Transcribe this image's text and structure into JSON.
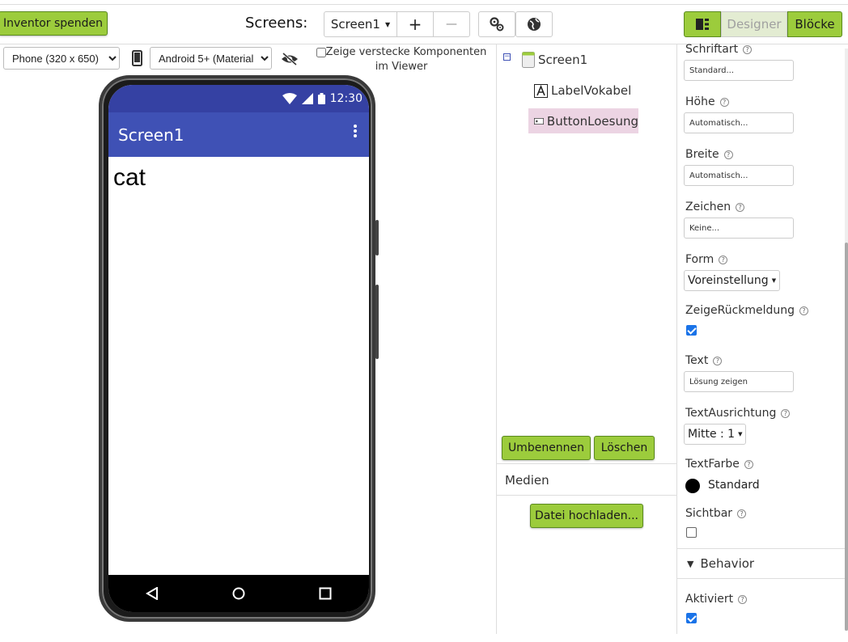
{
  "header": {
    "donate_label": "Inventor spenden",
    "screens_label": "Screens:",
    "current_screen": "Screen1",
    "add_screen": "+",
    "remove_screen": "—",
    "designer_label": "Designer",
    "blocks_label": "Blöcke"
  },
  "viewer": {
    "device_option": "Phone (320 x 650)",
    "theme_option": "Android 5+ (Material)",
    "hidden_components_label": "Zeige verstecke Komponenten im Viewer",
    "status_time": "12:30",
    "app_title": "Screen1",
    "label_text": "cat"
  },
  "tree": {
    "root": "Screen1",
    "items": [
      "LabelVokabel",
      "ButtonLoesung"
    ],
    "selected": "ButtonLoesung",
    "rename_label": "Umbenennen",
    "delete_label": "Löschen",
    "media_title": "Medien",
    "upload_label": "Datei hochladen..."
  },
  "properties": {
    "schriftart": {
      "label": "Schriftart",
      "value": "Standard..."
    },
    "hoehe": {
      "label": "Höhe",
      "value": "Automatisch..."
    },
    "breite": {
      "label": "Breite",
      "value": "Automatisch..."
    },
    "zeichen": {
      "label": "Zeichen",
      "value": "Keine..."
    },
    "form": {
      "label": "Form",
      "value": "Voreinstellung"
    },
    "feedback": {
      "label": "ZeigeRückmeldung",
      "checked": true
    },
    "text": {
      "label": "Text",
      "value": "Lösung zeigen"
    },
    "align": {
      "label": "TextAusrichtung",
      "value": "Mitte : 1"
    },
    "textcolor": {
      "label": "TextFarbe",
      "value": "Standard",
      "color": "#000000"
    },
    "visible": {
      "label": "Sichtbar",
      "checked": false
    },
    "behavior_title": "Behavior",
    "enabled": {
      "label": "Aktiviert",
      "checked": true
    }
  },
  "colors": {
    "accent_green": "#9ccc3c",
    "appbar": "#3f51b5",
    "selection": "#ecd4e3"
  }
}
